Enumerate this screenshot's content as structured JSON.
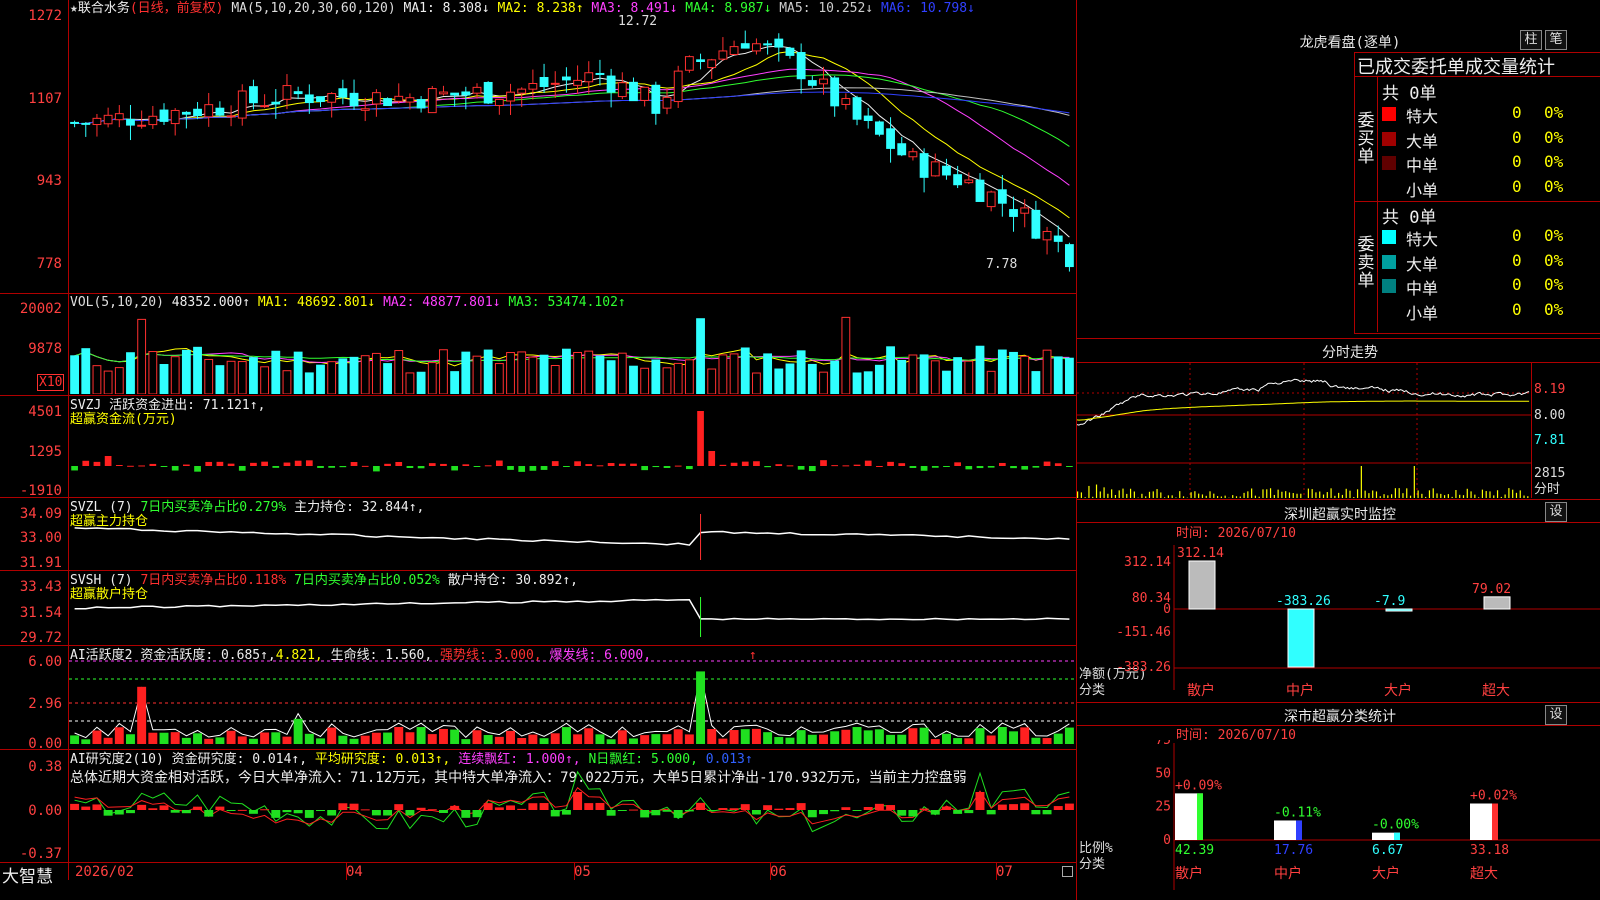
{
  "app_name": "大智慧",
  "stock_header": {
    "star": "★",
    "name": "联合水务",
    "mode": "(日线，前复权)",
    "ma_def": "MA(5,10,20,30,60,120)",
    "ma1": "MA1: 8.308↓",
    "ma2": "MA2: 8.238↑",
    "ma3": "MA3: 8.491↓",
    "ma4": "MA4: 8.987↓",
    "ma5": "MA5: 10.252↓",
    "ma6": "MA6: 10.798↓"
  },
  "price_axis": [
    "1272",
    "1107",
    "943",
    "778"
  ],
  "price_marks": {
    "high": "12.72",
    "low": "7.78"
  },
  "vol_header": {
    "def": "VOL(5,10,20)",
    "val": "48352.000↑",
    "ma1": "MA1: 48692.801↓",
    "ma2": "MA2: 48877.801↓",
    "ma3": "MA3: 53474.102↑"
  },
  "vol_axis": [
    "20002",
    "9878",
    "X10"
  ],
  "svzj": {
    "line1": "SVZJ  活跃资金进出: 71.121↑,",
    "line2": "超赢资金流(万元)",
    "axis": [
      "4501",
      "1295",
      "-1910"
    ]
  },
  "svzl": {
    "def": "SVZL (7)",
    "t1": "7日内买卖净占比0.279%",
    "t2": "主力持仓: 32.844↑,",
    "line2": "超赢主力持仓",
    "axis": [
      "34.09",
      "33.00",
      "31.91"
    ]
  },
  "svsh": {
    "def": "SVSH (7)",
    "t1": "7日内买卖净占比0.118%",
    "t2": "7日内买卖净占比0.052%",
    "t3": "散户持仓: 30.892↑,",
    "line2": "超赢散户持仓",
    "axis": [
      "33.43",
      "31.54",
      "29.72"
    ]
  },
  "ai1": {
    "def": "AI活跃度2",
    "t1": "资金活跃度: 0.685↑,",
    "t2": "4.821,",
    "t3": "生命线: 1.560,",
    "t4": "强势线: 3.000,",
    "t5": "爆发线: 6.000,",
    "arrow": "↑",
    "axis": [
      "6.00",
      "2.96",
      "0.00"
    ]
  },
  "ai2": {
    "def": "AI研究度2(10)",
    "t1": "资金研究度: 0.014↑,",
    "t2": "平均研究度: 0.013↑,",
    "t3": "连续飘红: 1.000↑,",
    "t4": "N日飘红: 5.000,",
    "t5": "0.013↑",
    "summary": "总体近期大资金相对活跃，今日大单净流入：71.12万元，其中特大单净流入：79.022万元，大单5日累计净出-170.932万元，当前主力控盘弱",
    "axis": [
      "0.38",
      "0.00",
      "-0.37"
    ]
  },
  "x_axis": [
    "2026/02",
    "04",
    "05",
    "06",
    "07"
  ],
  "dragon": {
    "title": "龙虎看盘(逐单)",
    "btn1": "柱",
    "btn2": "笔",
    "subtitle": "已成交委托单成交量统计",
    "buy_label": "委买单",
    "sell_label": "委卖单",
    "buy_total": "共 0单",
    "sell_total": "共 0单",
    "buy_rows": [
      {
        "name": "特大",
        "count": "0",
        "pct": "0%",
        "color": "#ff0000"
      },
      {
        "name": "大单",
        "count": "0",
        "pct": "0%",
        "color": "#a00000"
      },
      {
        "name": "中单",
        "count": "0",
        "pct": "0%",
        "color": "#600000"
      },
      {
        "name": "小单",
        "count": "0",
        "pct": "0%",
        "color": "#000000"
      }
    ],
    "sell_rows": [
      {
        "name": "特大",
        "count": "0",
        "pct": "0%",
        "color": "#00ffff"
      },
      {
        "name": "大单",
        "count": "0",
        "pct": "0%",
        "color": "#00a0a0"
      },
      {
        "name": "中单",
        "count": "0",
        "pct": "0%",
        "color": "#008080"
      },
      {
        "name": "小单",
        "count": "0",
        "pct": "0%",
        "color": "#000000"
      }
    ]
  },
  "intraday": {
    "title": "分时走势",
    "axis": [
      "8.19",
      "8.00",
      "7.81",
      "2815",
      "分时"
    ]
  },
  "monitor": {
    "title": "深圳超赢实时监控",
    "btn": "设",
    "time": "时间: 2026/07/10",
    "axis": [
      "312.14",
      "80.34",
      "0",
      "-151.46",
      "-383.26"
    ],
    "unit1": "净额(万元)",
    "unit2": "分类",
    "categories": [
      "散户",
      "中户",
      "大户",
      "超大"
    ],
    "bar_labels": [
      "312.14",
      "-383.26",
      "-7.9",
      "79.02"
    ]
  },
  "classify": {
    "title": "深市超赢分类统计",
    "btn": "设",
    "time": "时间: 2026/07/10",
    "axis": [
      "75",
      "50",
      "25",
      "0"
    ],
    "unit1": "比例%",
    "unit2": "分类",
    "categories": [
      "散户",
      "中户",
      "大户",
      "超大"
    ],
    "top_labels": [
      "+0.09%",
      "-0.11%",
      "-0.00%",
      "+0.02%"
    ],
    "bottom_labels": [
      "42.39",
      "17.76",
      "6.67",
      "33.18"
    ]
  },
  "chart_data": [
    {
      "type": "candlestick",
      "title": "联合水务 (日线，前复权)",
      "y_ticks": [
        12.72,
        11.07,
        9.43,
        7.78
      ],
      "y_range": [
        7.6,
        12.9
      ],
      "high": 12.72,
      "low": 7.78,
      "ma_last": {
        "MA1": 8.308,
        "MA2": 8.238,
        "MA3": 8.491,
        "MA4": 8.987,
        "MA5": 10.252,
        "MA6": 10.798
      }
    },
    {
      "type": "bar",
      "title": "VOL(5,10,20)",
      "last": 48352.0,
      "y_ticks": [
        20002,
        9878
      ]
    },
    {
      "type": "bar",
      "title": "超赢资金流(万元)",
      "last": 71.121,
      "y_ticks": [
        4501,
        1295,
        -1910
      ]
    },
    {
      "type": "line",
      "title": "超赢主力持仓",
      "last": 32.844,
      "y_ticks": [
        34.09,
        33.0,
        31.91
      ]
    },
    {
      "type": "line",
      "title": "超赢散户持仓",
      "last": 30.892,
      "y_ticks": [
        33.43,
        31.54,
        29.72
      ]
    },
    {
      "type": "bar",
      "title": "AI活跃度2",
      "last": 0.685,
      "y_ticks": [
        6.0,
        2.96,
        0.0
      ]
    },
    {
      "type": "bar",
      "title": "AI研究度2(10)",
      "last": 0.014,
      "y_ticks": [
        0.38,
        0.0,
        -0.37
      ]
    },
    {
      "type": "bar",
      "title": "深圳超赢实时监控",
      "categories": [
        "散户",
        "中户",
        "大户",
        "超大"
      ],
      "values": [
        312.14,
        -383.26,
        -7.9,
        79.02
      ],
      "ylabel": "净额(万元)"
    },
    {
      "type": "bar",
      "title": "深市超赢分类统计",
      "categories": [
        "散户",
        "中户",
        "大户",
        "超大"
      ],
      "values": [
        42.39,
        17.76,
        6.67,
        33.18
      ],
      "changes": [
        "+0.09%",
        "-0.11%",
        "-0.00%",
        "+0.02%"
      ],
      "ylabel": "比例%",
      "ylim": [
        0,
        75
      ]
    }
  ]
}
